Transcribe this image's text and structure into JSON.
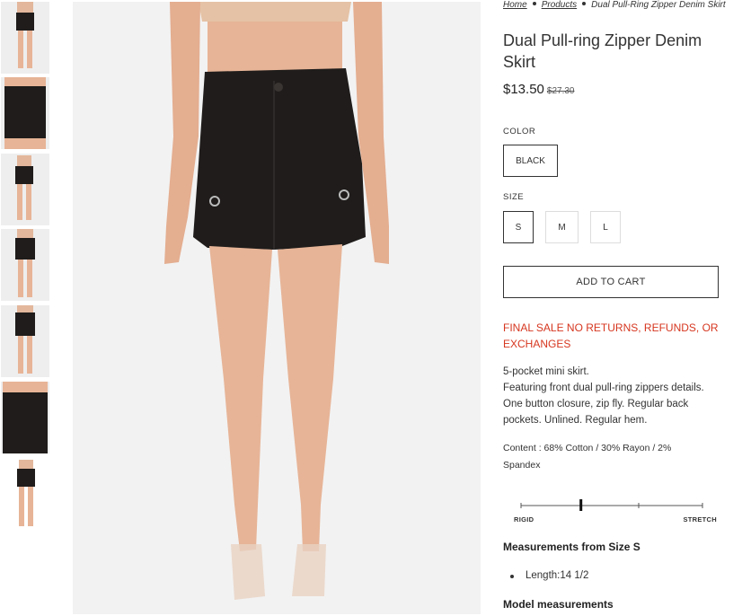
{
  "breadcrumb": {
    "home": "Home",
    "products": "Products",
    "current": "Dual Pull-Ring Zipper Denim Skirt"
  },
  "product": {
    "title": "Dual Pull-ring Zipper Denim Skirt",
    "price": "$13.50",
    "compare_price": "$27.30"
  },
  "color": {
    "label": "COLOR",
    "options": [
      "BLACK"
    ],
    "selected": "BLACK"
  },
  "size": {
    "label": "SIZE",
    "options": [
      "S",
      "M",
      "L"
    ],
    "selected": "S"
  },
  "add_to_cart": "ADD TO CART",
  "final_sale": "FINAL SALE NO RETURNS, REFUNDS, OR EXCHANGES",
  "description": {
    "line1": "5-pocket mini skirt.",
    "line2": "Featuring front dual pull-ring zippers details. One button closure, zip fly. Regular back pockets. Unlined. Regular hem."
  },
  "content": "Content : 68% Cotton / 30% Rayon / 2% Spandex",
  "stretch_scale": {
    "left_label": "RIGID",
    "right_label": "STRETCH",
    "level": 0.33
  },
  "measurements": {
    "title": "Measurements from Size S",
    "items": [
      "Length:14 1/2"
    ]
  },
  "model_measurements": {
    "title": "Model measurements"
  },
  "gallery": {
    "thumbnail_count": 7
  },
  "colors": {
    "accent_red": "#d6361f",
    "skirt": "#1f1c1b",
    "skin": "#e7b497"
  }
}
